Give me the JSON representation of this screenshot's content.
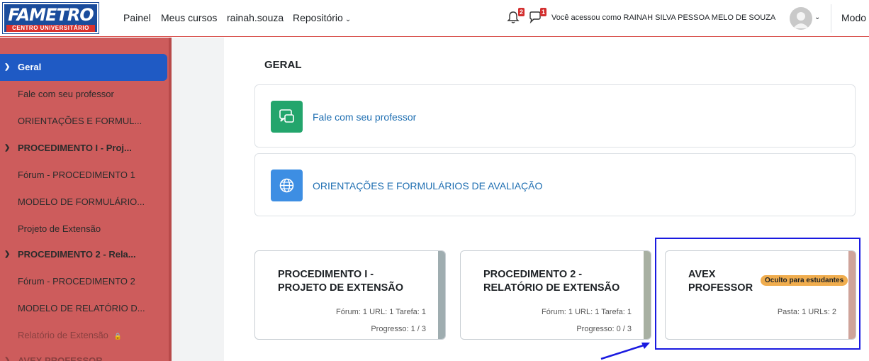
{
  "logo": {
    "main": "FAMETRO",
    "sub": "CENTRO UNIVERSITÁRIO"
  },
  "nav": {
    "links": [
      {
        "label": "Painel"
      },
      {
        "label": "Meus cursos"
      },
      {
        "label": "rainah.souza"
      },
      {
        "label": "Repositório"
      }
    ],
    "notifications_count": "2",
    "messages_count": "1",
    "user_text": "Você acessou como RAINAH SILVA PESSOA MELO DE SOUZA",
    "mode_label": "Modo"
  },
  "sidebar": {
    "items": [
      {
        "label": "Geral",
        "type": "section"
      },
      {
        "label": "Fale com seu professor",
        "type": "item"
      },
      {
        "label": "ORIENTAÇÕES E FORMUL...",
        "type": "item"
      },
      {
        "label": "PROCEDIMENTO I - Proj...",
        "type": "section"
      },
      {
        "label": "Fórum - PROCEDIMENTO 1",
        "type": "item"
      },
      {
        "label": "MODELO DE FORMULÁRIO...",
        "type": "item"
      },
      {
        "label": "Projeto de Extensão",
        "type": "item"
      },
      {
        "label": "PROCEDIMENTO 2 - Rela...",
        "type": "section"
      },
      {
        "label": "Fórum - PROCEDIMENTO 2",
        "type": "item"
      },
      {
        "label": "MODELO DE RELATÓRIO D...",
        "type": "item"
      },
      {
        "label": "Relatório de Extensão",
        "type": "item-locked"
      },
      {
        "label": "AVEX PROFESSOR",
        "type": "section"
      }
    ]
  },
  "main": {
    "section_title": "GERAL",
    "activities": [
      {
        "label": "Fale com seu professor",
        "icon": "forum-icon"
      },
      {
        "label": "ORIENTAÇÕES E FORMULÁRIOS DE AVALIAÇÃO",
        "icon": "globe-icon"
      }
    ],
    "cards": [
      {
        "title": "PROCEDIMENTO I - PROJETO DE EXTENSÃO",
        "stats": "Fórum: 1   URL: 1   Tarefa: 1",
        "progress": "Progresso: 1 / 3"
      },
      {
        "title": "PROCEDIMENTO 2 - RELATÓRIO DE EXTENSÃO",
        "stats": "Fórum: 1   URL: 1   Tarefa: 1",
        "progress": "Progresso: 0 / 3"
      },
      {
        "title": "AVEX PROFESSOR",
        "stats": "Pasta: 1   URLs: 2",
        "progress": ""
      }
    ],
    "hidden_badge": "Oculto para estudantes"
  },
  "colors": {
    "brand_blue": "#1a4c9c",
    "sidebar_bg": "#cd5c5c",
    "active_item": "#1f5ac4",
    "link": "#1f6fb2",
    "forum_icon_bg": "#23a56c",
    "url_icon_bg": "#3d8ee3",
    "badge_warning": "#f0ad4e"
  }
}
